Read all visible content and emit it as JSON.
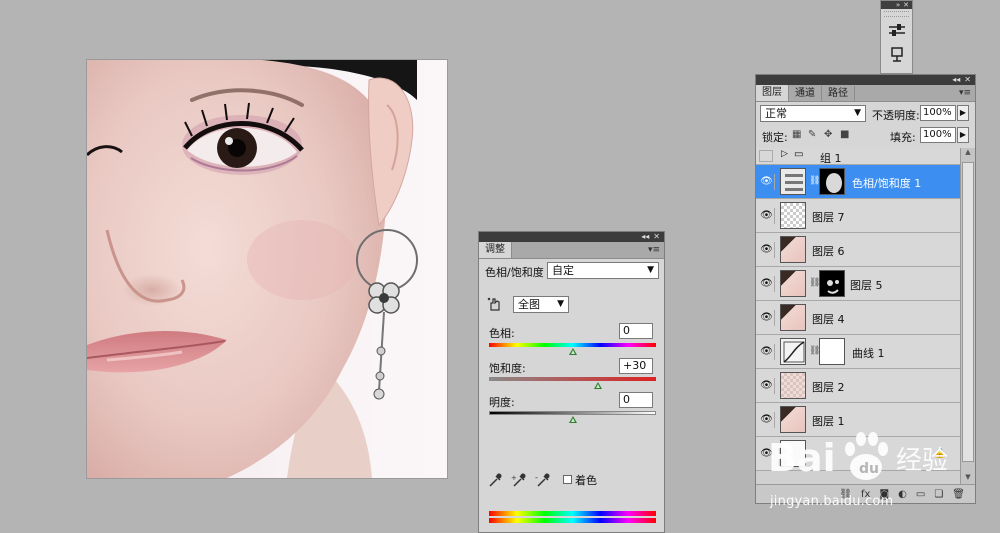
{
  "photo": {
    "subject": "portrait"
  },
  "adjustments_panel": {
    "tab_label": "调整",
    "preset_type": "色相/饱和度",
    "preset_value": "自定",
    "channel": "全图",
    "hue_label": "色相:",
    "hue_value": "0",
    "hue_level": 0.5,
    "saturation_label": "饱和度:",
    "saturation_value": "+30",
    "saturation_level": 0.65,
    "lightness_label": "明度:",
    "lightness_value": "0",
    "lightness_level": 0.5,
    "colorize_label": "着色"
  },
  "layers_panel": {
    "tabs": [
      "图层",
      "通道",
      "路径"
    ],
    "blend_mode": "正常",
    "opacity_label": "不透明度:",
    "opacity_value": "100%",
    "lock_label": "锁定:",
    "fill_label": "填充:",
    "fill_value": "100%",
    "layers": [
      {
        "name": "组 1",
        "kind": "group",
        "visible": false
      },
      {
        "name": "色相/饱和度 1",
        "kind": "adjustment",
        "visible": true,
        "selected": true
      },
      {
        "name": "图层 7",
        "kind": "transparent",
        "visible": true
      },
      {
        "name": "图层 6",
        "kind": "face",
        "visible": true
      },
      {
        "name": "图层 5",
        "kind": "face-mask",
        "visible": true
      },
      {
        "name": "图层 4",
        "kind": "face",
        "visible": true
      },
      {
        "name": "曲线 1",
        "kind": "curves",
        "visible": true
      },
      {
        "name": "图层 2",
        "kind": "face-light",
        "visible": true
      },
      {
        "name": "图层 1",
        "kind": "face",
        "visible": true
      }
    ]
  },
  "watermark": {
    "brand": "Bai",
    "brand_cn": "经验",
    "url": "jingyan.baidu.com"
  },
  "colors": {
    "selection": "#3c8ef0",
    "panel_bg": "#d6d6d6",
    "workspace_bg": "#b4b4b4"
  }
}
